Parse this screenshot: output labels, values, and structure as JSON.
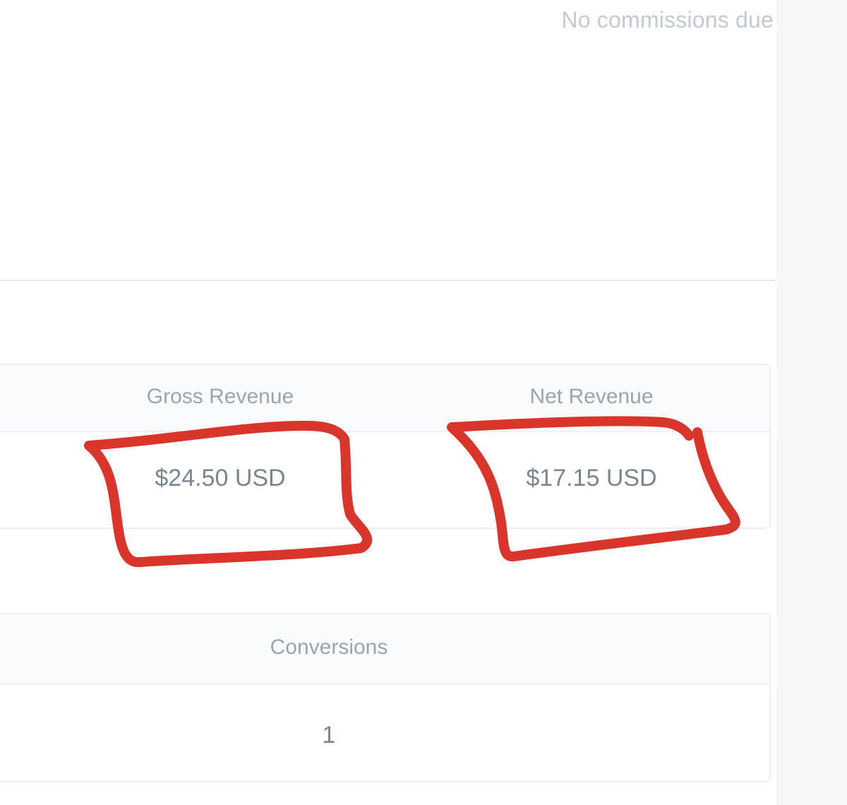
{
  "header": {
    "commissions_note": "No commissions due"
  },
  "revenue_table": {
    "columns": [
      {
        "label": "Gross Revenue",
        "value": "$24.50 USD"
      },
      {
        "label": "Net Revenue",
        "value": "$17.15 USD"
      }
    ]
  },
  "conversions_table": {
    "label": "Conversions",
    "value": "1"
  },
  "annotation": {
    "stroke_color": "#d9352a"
  }
}
